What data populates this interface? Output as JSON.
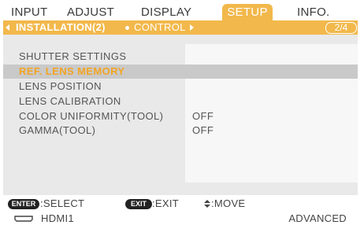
{
  "tabs": [
    {
      "label": "INPUT",
      "active": false
    },
    {
      "label": "ADJUST",
      "active": false
    },
    {
      "label": "DISPLAY",
      "active": false
    },
    {
      "label": "SETUP",
      "active": true
    },
    {
      "label": "INFO.",
      "active": false
    }
  ],
  "subbar": {
    "active": "INSTALLATION(2)",
    "other": "CONTROL",
    "page": "2/4"
  },
  "menu": [
    {
      "label": "SHUTTER SETTINGS",
      "value": "",
      "selected": false
    },
    {
      "label": "REF. LENS MEMORY",
      "value": "",
      "selected": true
    },
    {
      "label": "LENS POSITION",
      "value": "",
      "selected": false
    },
    {
      "label": "LENS CALIBRATION",
      "value": "",
      "selected": false
    },
    {
      "label": "COLOR UNIFORMITY(TOOL)",
      "value": "OFF",
      "selected": false
    },
    {
      "label": "GAMMA(TOOL)",
      "value": "OFF",
      "selected": false
    }
  ],
  "footer": {
    "enter_key": "ENTER",
    "select_hint": ":SELECT",
    "exit_key": "EXIT",
    "exit_hint": ":EXIT",
    "move_hint": ":MOVE"
  },
  "status": {
    "input": "HDMI1",
    "mode": "ADVANCED"
  },
  "colors": {
    "accent": "#f2b84b",
    "selected_text": "#f2a424",
    "panel": "#e9e9e9",
    "selected_row": "#c9c9c9"
  }
}
